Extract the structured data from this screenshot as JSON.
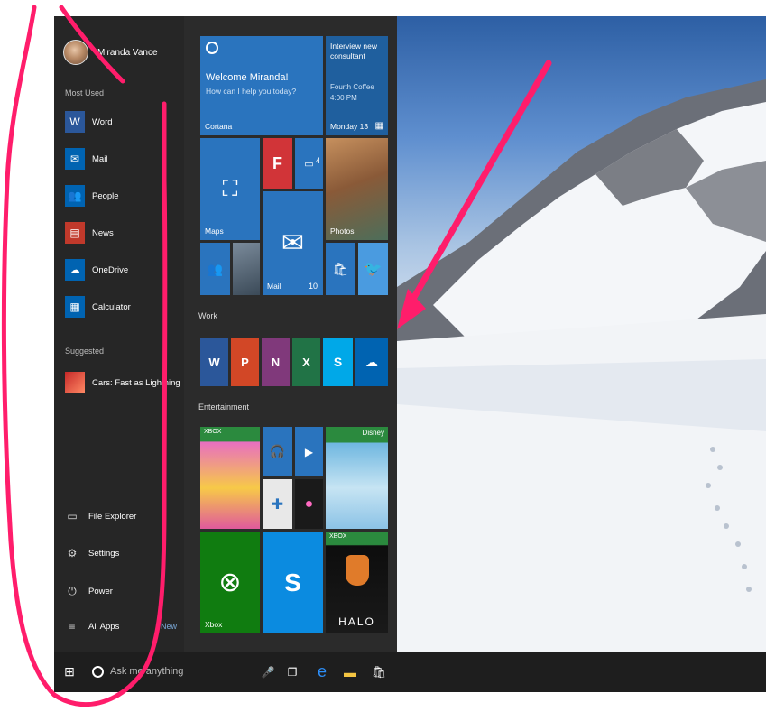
{
  "user": {
    "name": "Miranda Vance"
  },
  "left_menu": {
    "most_used_label": "Most Used",
    "apps": [
      {
        "label": "Word",
        "icon": "word-icon",
        "color": "#2b579a"
      },
      {
        "label": "Mail",
        "icon": "mail-icon",
        "color": "#0063b1"
      },
      {
        "label": "People",
        "icon": "people-icon",
        "color": "#0063b1"
      },
      {
        "label": "News",
        "icon": "news-icon",
        "color": "#c0392b"
      },
      {
        "label": "OneDrive",
        "icon": "onedrive-icon",
        "color": "#0063b1"
      },
      {
        "label": "Calculator",
        "icon": "calculator-icon",
        "color": "#0063b1"
      }
    ],
    "suggested_label": "Suggested",
    "suggested_app": {
      "label": "Cars: Fast as Lightning",
      "icon": "cars-game-icon"
    },
    "bottom": [
      {
        "label": "File Explorer",
        "icon": "folder-icon"
      },
      {
        "label": "Settings",
        "icon": "gear-icon"
      },
      {
        "label": "Power",
        "icon": "power-icon"
      },
      {
        "label": "All Apps",
        "icon": "list-icon"
      }
    ],
    "new_badge": "New"
  },
  "tiles": {
    "cortana": {
      "title": "Welcome Miranda!",
      "subtitle": "How can I help you today?",
      "label": "Cortana"
    },
    "calendar": {
      "event": "Interview new consultant",
      "place": "Fourth Coffee",
      "time": "4:00 PM",
      "date": "Monday 13"
    },
    "maps_label": "Maps",
    "photos_label": "Photos",
    "mail": {
      "label": "Mail",
      "count": "10"
    },
    "messaging_count": "4",
    "work_label": "Work",
    "entertainment_label": "Entertainment",
    "xbox_badge": "XBOX",
    "xbox_label": "Xbox",
    "disney_label": "Disney",
    "halo_label": "HALO"
  },
  "taskbar": {
    "search_placeholder": "Ask me anything"
  },
  "colors": {
    "accent": "#1b6db5",
    "annotation": "#ff1d6b",
    "tile_blue": "#2a74be",
    "tile_dark_blue": "#1f5f9e"
  }
}
